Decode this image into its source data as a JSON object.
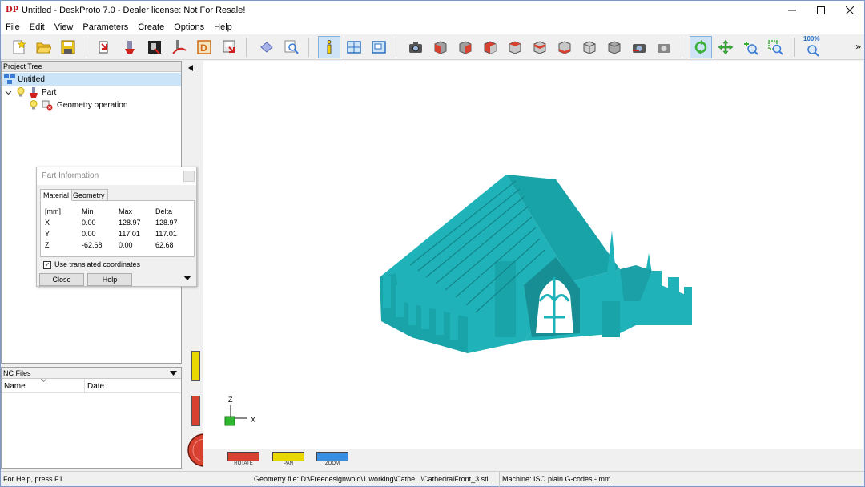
{
  "window": {
    "title": "Untitled - DeskProto 7.0 - Dealer license: Not For Resale!",
    "logo": "DP"
  },
  "menu": [
    "File",
    "Edit",
    "View",
    "Parameters",
    "Create",
    "Options",
    "Help"
  ],
  "toolbar": {
    "zoom_label": "100%",
    "icons": [
      "new-project-icon",
      "open-project-icon",
      "save-project-icon",
      "import-geometry-icon",
      "part-parameters-icon",
      "operation-parameters-icon",
      "toolpath-icon",
      "dealer-icon",
      "save-nc-icon",
      "render-icon",
      "preview-icon",
      "info-icon",
      "split-view-icon",
      "layout-view-icon",
      "snapshot-icon",
      "view-front-icon",
      "view-back-icon",
      "view-left-icon",
      "view-right-icon",
      "view-top-icon",
      "view-bottom-icon",
      "view-iso-icon",
      "view-iso2-icon",
      "reset-view-icon",
      "copy-view-icon",
      "rotate-icon",
      "pan-icon",
      "zoom-in-icon",
      "zoom-window-icon",
      "zoom-fit-icon"
    ]
  },
  "project_tree": {
    "header": "Project Tree",
    "items": [
      {
        "label": "Untitled",
        "icon": "project-icon"
      },
      {
        "label": "Part",
        "icon": "part-icon"
      },
      {
        "label": "Geometry operation",
        "icon": "geometry-operation-icon"
      }
    ]
  },
  "nc_files": {
    "header": "NC Files",
    "columns": [
      "Name",
      "Date"
    ]
  },
  "part_info": {
    "title": "Part Information",
    "tabs": [
      "Material",
      "Geometry"
    ],
    "headers": [
      "[mm]",
      "Min",
      "Max",
      "Delta"
    ],
    "rows": [
      [
        "X",
        "0.00",
        "128.97",
        "128.97"
      ],
      [
        "Y",
        "0.00",
        "117.01",
        "117.01"
      ],
      [
        "Z",
        "-62.68",
        "0.00",
        "62.68"
      ]
    ],
    "checkbox_label": "Use translated coordinates",
    "checkbox_checked": true,
    "close_label": "Close",
    "help_label": "Help"
  },
  "viewport": {
    "axis_z": "Z",
    "axis_x": "X",
    "model_color": "#1fb2b8"
  },
  "view_controls": [
    "ROTATE",
    "PAN",
    "ZOOM"
  ],
  "status": {
    "help": "For Help, press F1",
    "geometry": "Geometry file: D:\\Freedesignwold\\1.working\\Cathe...\\CathedralFront_3.stl",
    "machine": "Machine: ISO plain G-codes - mm"
  }
}
